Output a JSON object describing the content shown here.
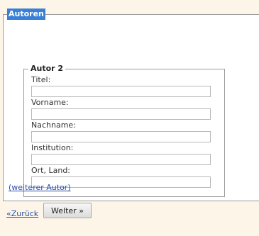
{
  "authors_section": {
    "legend": "Autoren",
    "author": {
      "legend": "Autor 2",
      "fields": [
        {
          "label": "Titel:",
          "value": ""
        },
        {
          "label": "Vorname:",
          "value": ""
        },
        {
          "label": "Nachname:",
          "value": ""
        },
        {
          "label": "Institution:",
          "value": ""
        },
        {
          "label": "Ort, Land:",
          "value": ""
        }
      ]
    },
    "add_author_open": "(",
    "add_author_label": "weiterer Autor",
    "add_author_close": ")"
  },
  "navigation": {
    "back_label": "«Zurück",
    "next_label": "Welter »"
  }
}
